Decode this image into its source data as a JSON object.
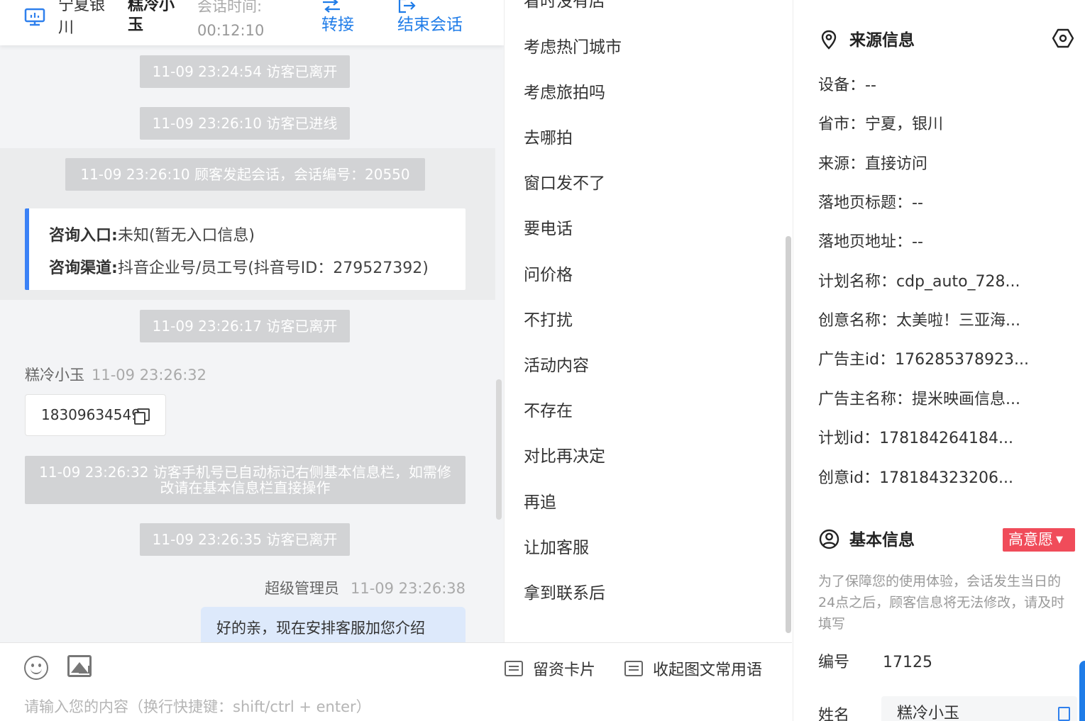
{
  "header": {
    "location": "宁夏银川",
    "visitor_name": "糕冷小玉",
    "time_label": "会话时间:",
    "time_value": "00:12:10",
    "transfer_label": "转接",
    "end_label": "结束会话",
    "icons": [
      "monitor-icon",
      "transfer-icon",
      "exit-icon"
    ]
  },
  "chat": {
    "events": [
      "11-09 23:24:54 访客已离开",
      "11-09 23:26:10 访客已进线",
      "11-09 23:26:10 顾客发起会话，会话编号：20550",
      "11-09 23:26:17 访客已离开",
      "11-09 23:26:35 访客已离开"
    ],
    "consult_entry_label": "咨询入口:",
    "consult_entry_value": "未知(暂无入口信息)",
    "consult_channel_label": "咨询渠道:",
    "consult_channel_value": "抖音企业号/员工号(抖音号ID：279527392)",
    "visitor_msg": {
      "sender": "糕冷小玉",
      "time": "11-09 23:26:32",
      "text": "18309634549"
    },
    "auto_note": "11-09 23:26:32 访客手机号已自动标记右侧基本信息栏，如需修改请在基本信息栏直接操作",
    "agent_msg": {
      "sender": "超级管理员",
      "time": "11-09 23:26:38",
      "text": "好的亲，现在安排客服加您介绍"
    }
  },
  "phrases": {
    "partial_top": "看时没有店",
    "items": [
      "考虑热门城市",
      "考虑旅拍吗",
      "去哪拍",
      "窗口发不了",
      "要电话",
      "问价格",
      "不打扰",
      "活动内容",
      "不存在",
      "对比再决定",
      "再追",
      "让加客服",
      "拿到联系后"
    ]
  },
  "input": {
    "placeholder": "请输入您的内容（换行快捷键：shift/ctrl + enter）",
    "card_label": "留资卡片",
    "collapse_label": "收起图文常用语"
  },
  "source_info": {
    "title": "来源信息",
    "rows": [
      "设备：--",
      "省市：宁夏，银川",
      "来源：直接访问",
      "落地页标题：--",
      "落地页地址：--",
      "计划名称：cdp_auto_728...",
      "创意名称：太美啦！三亚海...",
      "广告主id：176285378923...",
      "广告主名称：提米映画信息...",
      "计划id：178184264184...",
      "创意id：178184323206..."
    ]
  },
  "basic_info": {
    "title": "基本信息",
    "intent_badge": "高意愿",
    "intent_color": "#f04c5a",
    "notice": "为了保障您的使用体验，会话发生当日的24点之后，顾客信息将无法修改，请及时填写",
    "id_label": "编号",
    "id_value": "17125",
    "name_label": "姓名",
    "name_value": "糕冷小玉"
  },
  "colors": {
    "accent": "#1f7ce8",
    "system_pill": "#d2d3d5",
    "agent_bubble": "#dde9fb"
  }
}
